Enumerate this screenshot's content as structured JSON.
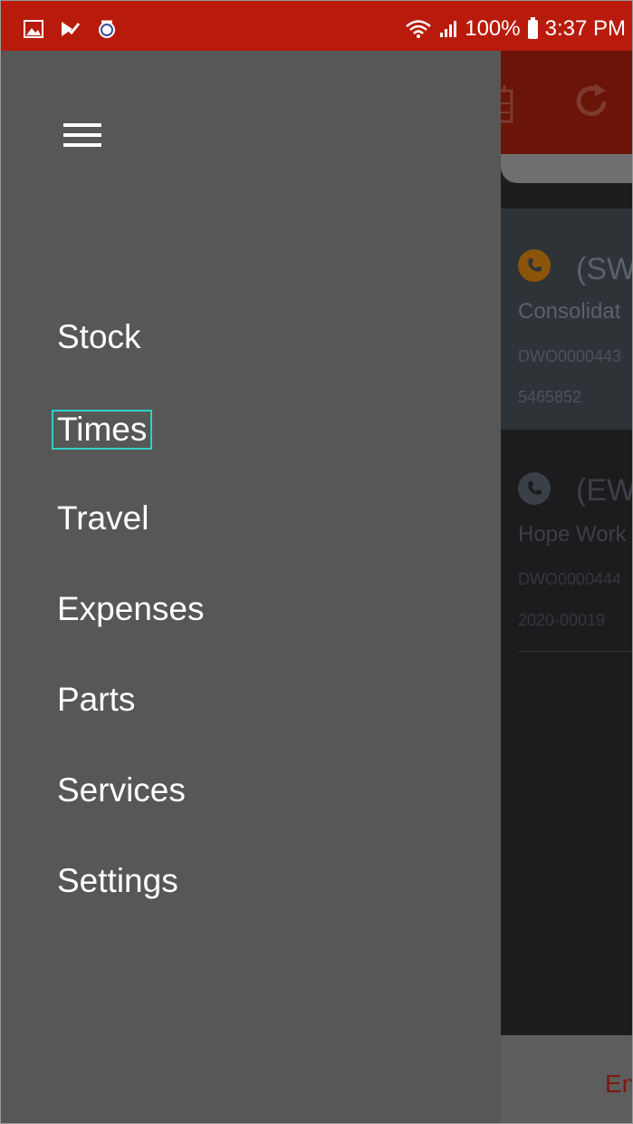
{
  "status_bar": {
    "battery": "100%",
    "time": "3:37 PM",
    "bg_color": "#b81b0c"
  },
  "drawer": {
    "menu_icon": "hamburger-icon",
    "items": [
      {
        "label": "Stock"
      },
      {
        "label": "Times",
        "selected": true
      },
      {
        "label": "Travel"
      },
      {
        "label": "Expenses"
      },
      {
        "label": "Parts"
      },
      {
        "label": "Services"
      },
      {
        "label": "Settings"
      }
    ]
  },
  "background": {
    "jobs": [
      {
        "title": "(SW",
        "subtitle": "Consolidat",
        "code": "DWO0000443",
        "ref": "5465852",
        "icon_color": "#8a5508"
      },
      {
        "title": "(EW",
        "subtitle": "Hope Work",
        "code": "DWO0000444",
        "ref": "2020-00019",
        "icon_color": "#3a3f48"
      }
    ],
    "bottom_label": "En"
  }
}
